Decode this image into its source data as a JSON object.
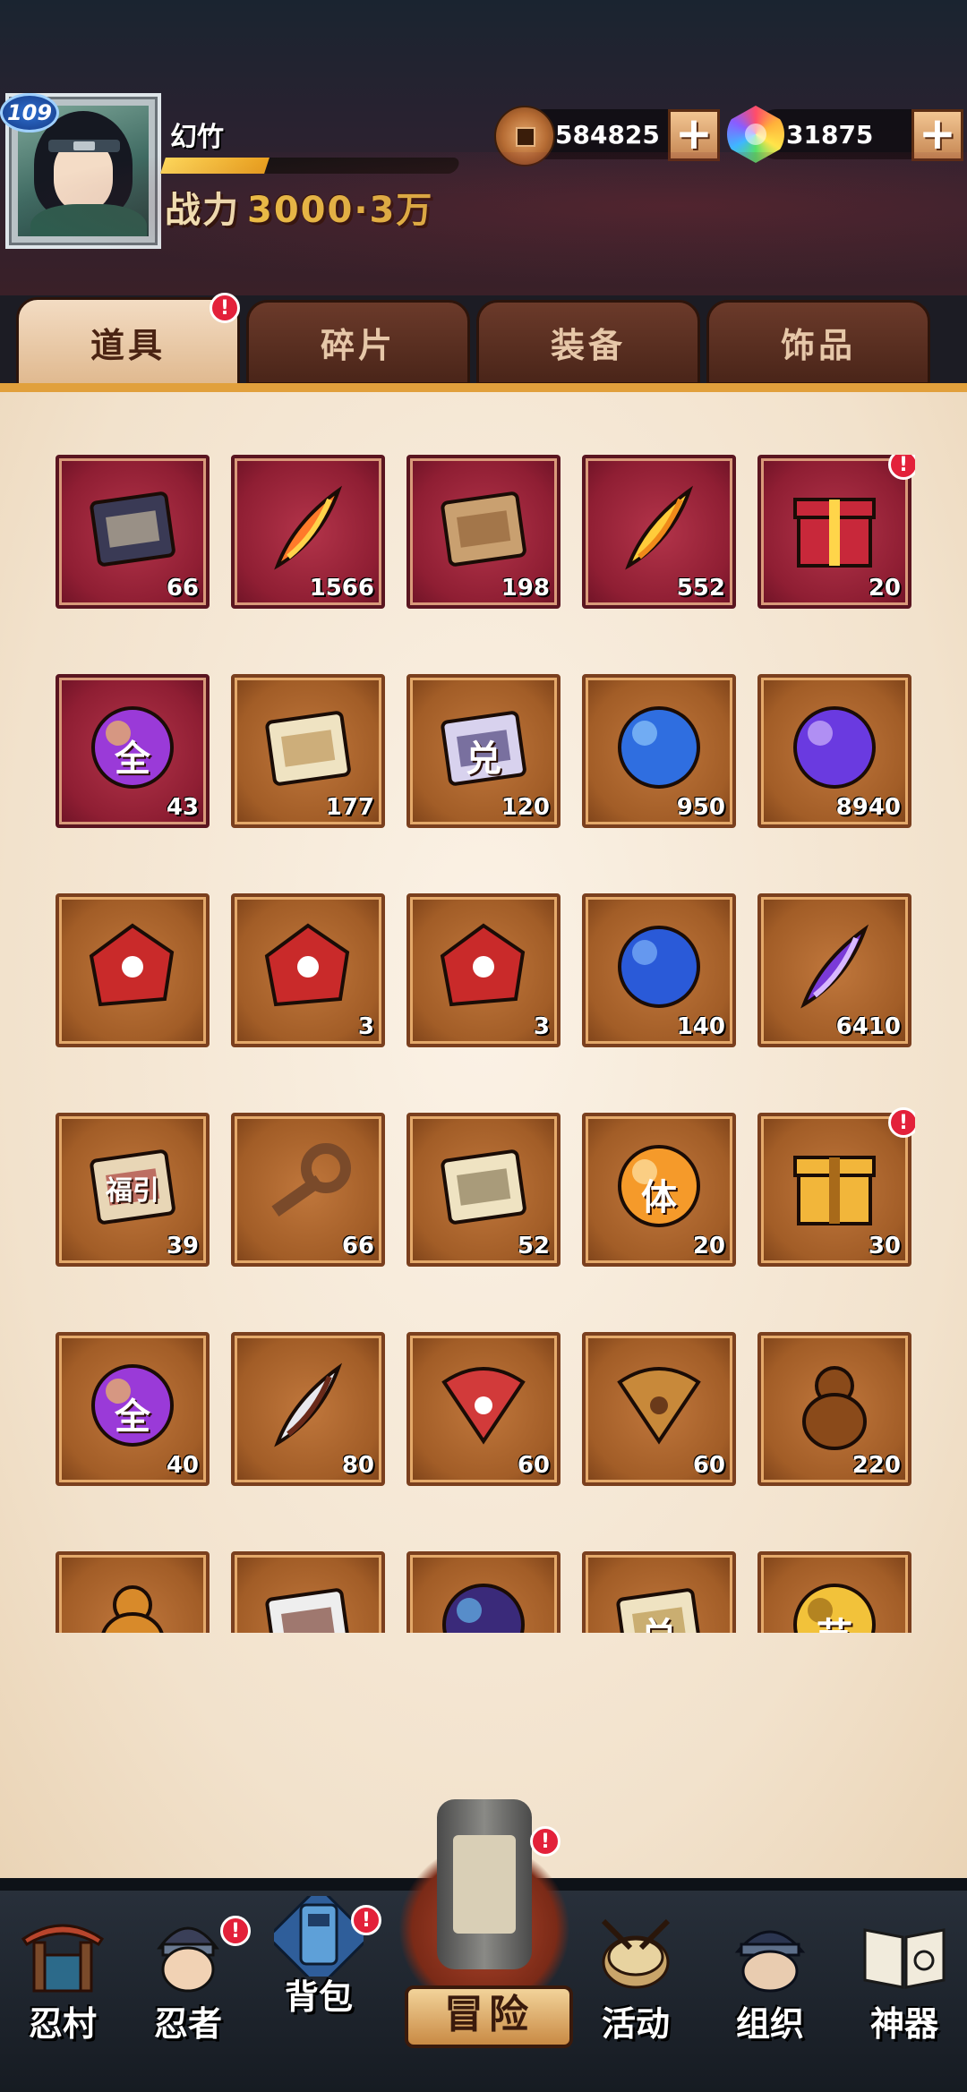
{
  "player": {
    "level": "109",
    "name": "幻竹",
    "exp_fraction": 0.35,
    "power_label": "战力",
    "power_value": "3000·3万"
  },
  "resources": {
    "coins": "584825",
    "gems": "31875",
    "plus_label": "+"
  },
  "tabs": [
    {
      "label": "道具",
      "active": true,
      "alert": "!"
    },
    {
      "label": "碎片",
      "active": false
    },
    {
      "label": "装备",
      "active": false
    },
    {
      "label": "饰品",
      "active": false
    }
  ],
  "items": [
    {
      "icon": "scroll-bundle-icon",
      "count": "66",
      "bg": "red"
    },
    {
      "icon": "flame-feather-icon",
      "count": "1566",
      "bg": "red"
    },
    {
      "icon": "stick-icon",
      "count": "198",
      "bg": "red"
    },
    {
      "icon": "golden-feather-icon",
      "count": "552",
      "bg": "red"
    },
    {
      "icon": "gift-box-icon",
      "count": "20",
      "bg": "red",
      "alert": "!"
    },
    {
      "icon": "all-badge-icon",
      "count": "43",
      "bg": "red",
      "glyph": "全"
    },
    {
      "icon": "map-scroll-icon",
      "count": "177",
      "bg": "brown"
    },
    {
      "icon": "exchange-banner-icon",
      "count": "120",
      "bg": "brown",
      "glyph": "兑"
    },
    {
      "icon": "blue-orb-icon",
      "count": "950",
      "bg": "brown"
    },
    {
      "icon": "purple-orb-icon",
      "count": "8940",
      "bg": "brown"
    },
    {
      "icon": "red-stone-figure-icon",
      "count": "",
      "bg": "brown"
    },
    {
      "icon": "red-stone-target-icon",
      "count": "3",
      "bg": "brown"
    },
    {
      "icon": "red-stone-eye-icon",
      "count": "3",
      "bg": "brown"
    },
    {
      "icon": "blue-moon-icon",
      "count": "140",
      "bg": "brown"
    },
    {
      "icon": "purple-crystal-icon",
      "count": "6410",
      "bg": "brown"
    },
    {
      "icon": "fortune-ticket-icon",
      "count": "39",
      "bg": "brown",
      "glyph": "福引"
    },
    {
      "icon": "key-icon",
      "count": "66",
      "bg": "brown"
    },
    {
      "icon": "seal-paper-icon",
      "count": "52",
      "bg": "brown"
    },
    {
      "icon": "stamina-badge-icon",
      "count": "20",
      "bg": "brown",
      "glyph": "体"
    },
    {
      "icon": "golden-chest-icon",
      "count": "30",
      "bg": "brown",
      "alert": "!"
    },
    {
      "icon": "all-badge-purple-icon",
      "count": "40",
      "bg": "brown",
      "glyph": "全"
    },
    {
      "icon": "white-sword-icon",
      "count": "80",
      "bg": "brown"
    },
    {
      "icon": "red-fan-icon",
      "count": "60",
      "bg": "brown"
    },
    {
      "icon": "rope-icon",
      "count": "60",
      "bg": "brown"
    },
    {
      "icon": "gourd-icon",
      "count": "220",
      "bg": "brown"
    },
    {
      "icon": "jar-icon",
      "count": "",
      "bg": "brown"
    },
    {
      "icon": "mask-icon",
      "count": "",
      "bg": "brown"
    },
    {
      "icon": "blue-flame-orb-icon",
      "count": "",
      "bg": "brown"
    },
    {
      "icon": "exchange-ticket-icon",
      "count": "",
      "bg": "brown",
      "glyph": "兑"
    },
    {
      "icon": "gold-festival-coin-icon",
      "count": "",
      "bg": "brown",
      "glyph": "节"
    }
  ],
  "nav": {
    "village": "忍村",
    "ninja": "忍者",
    "bag": "背包",
    "adventure": "冒险",
    "activity": "活动",
    "guild": "组织",
    "artifact": "神器",
    "alert": "!"
  },
  "colors": {
    "accent_gold": "#e1a03c",
    "alert_red": "#e3213a",
    "panel_bg": "#f2e2cc",
    "red_cell": "#8f1e33",
    "brown_cell": "#a25d27"
  }
}
